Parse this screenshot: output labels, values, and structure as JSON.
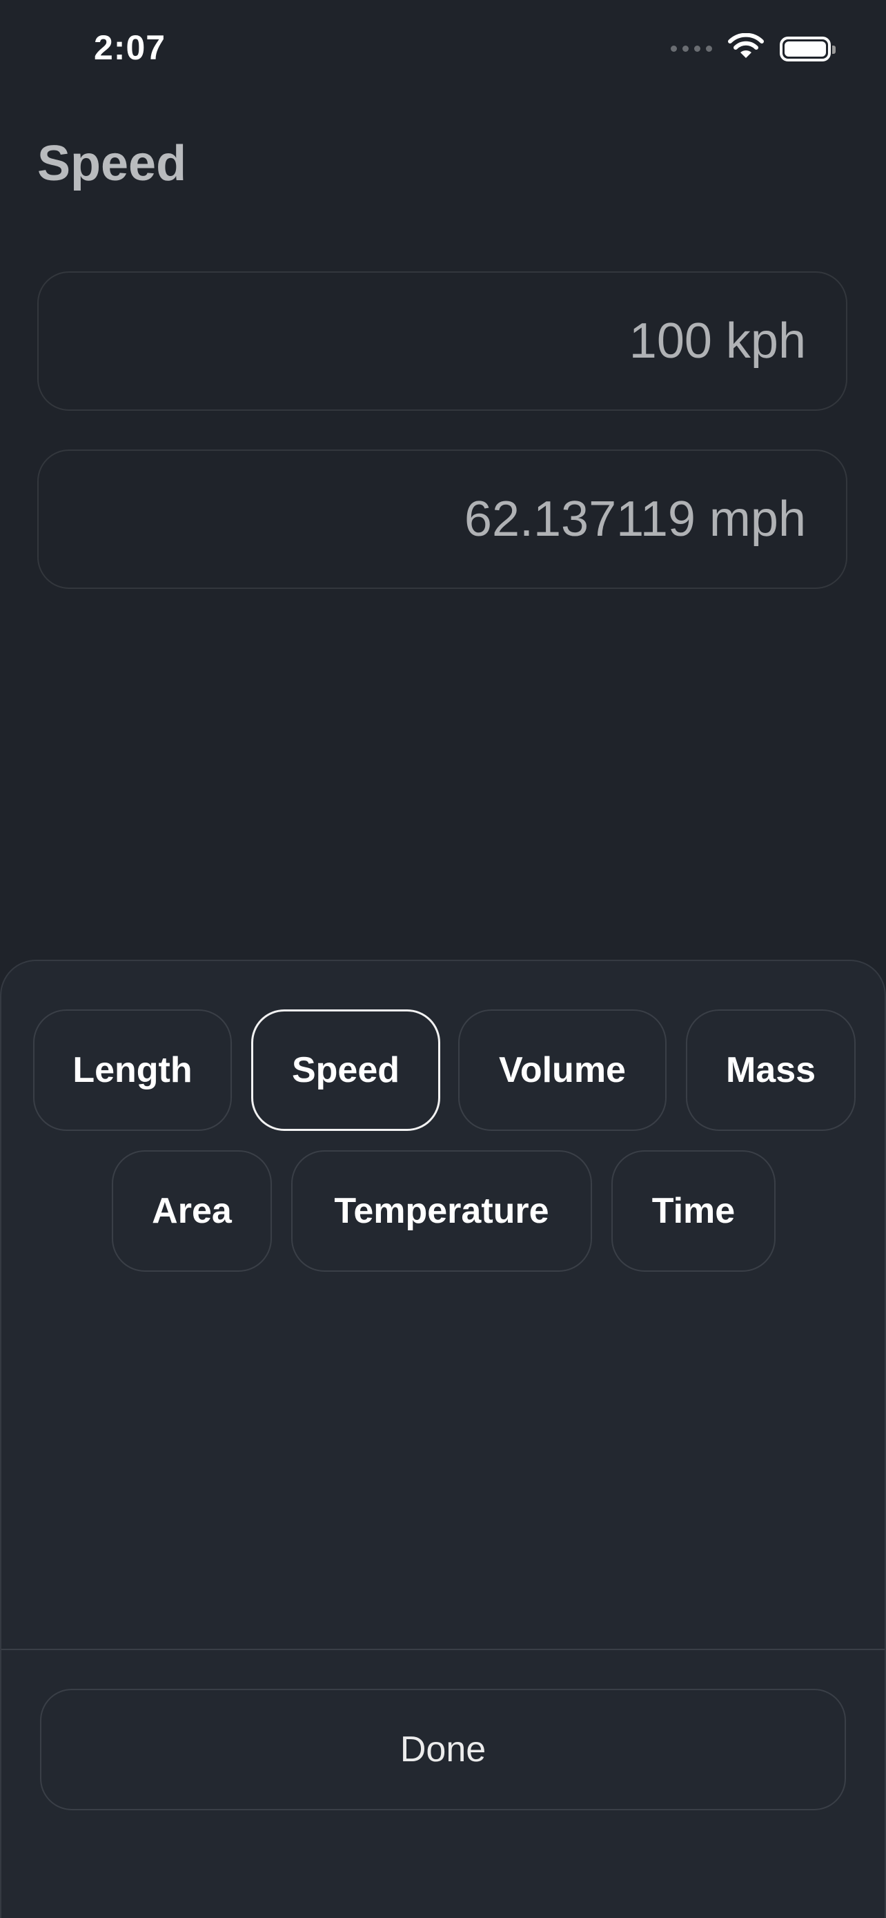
{
  "status_bar": {
    "time": "2:07",
    "icons": [
      "signal-dots-icon",
      "wifi-icon",
      "battery-icon"
    ]
  },
  "screen": {
    "title": "Speed",
    "input_value": "100 kph",
    "output_value": "62.137119 mph"
  },
  "sheet": {
    "categories": [
      {
        "label": "Length",
        "selected": false
      },
      {
        "label": "Speed",
        "selected": true
      },
      {
        "label": "Volume",
        "selected": false
      },
      {
        "label": "Mass",
        "selected": false
      },
      {
        "label": "Area",
        "selected": false
      },
      {
        "label": "Temperature",
        "selected": false
      },
      {
        "label": "Time",
        "selected": false
      }
    ],
    "done_label": "Done"
  },
  "colors": {
    "background": "#1f232a",
    "sheet": "#232830",
    "selected_border": "#f2f2f2",
    "text": "#ffffff"
  }
}
